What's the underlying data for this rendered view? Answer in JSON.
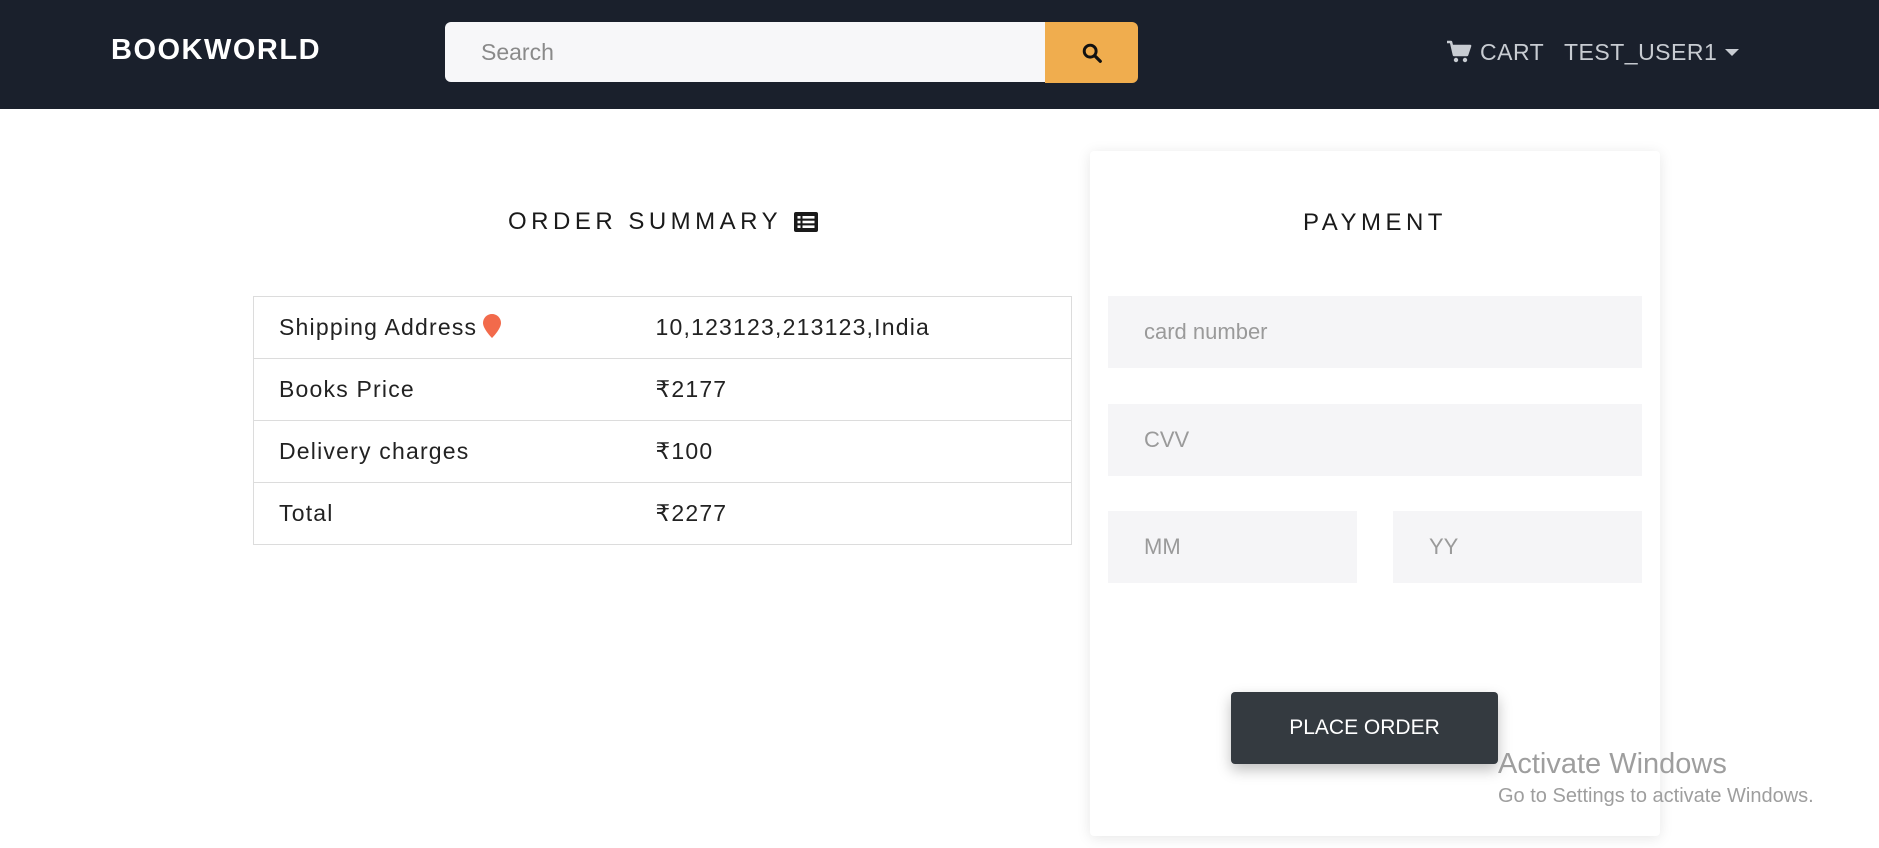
{
  "navbar": {
    "brand": "BOOKWORLD",
    "search_placeholder": "Search",
    "cart_label": "CART",
    "user_label": "TEST_USER1"
  },
  "order_summary": {
    "title": "ORDER SUMMARY",
    "rows": [
      {
        "label": "Shipping Address",
        "value": "10,123123,213123,India"
      },
      {
        "label": "Books Price",
        "value": "₹2177"
      },
      {
        "label": "Delivery charges",
        "value": "₹100"
      },
      {
        "label": "Total",
        "value": "₹2277"
      }
    ]
  },
  "payment": {
    "title": "PAYMENT",
    "card_number_placeholder": "card number",
    "cvv_placeholder": "CVV",
    "mm_placeholder": "MM",
    "yy_placeholder": "YY",
    "place_order_label": "PLACE ORDER"
  },
  "watermark": {
    "title": "Activate Windows",
    "subtitle": "Go to Settings to activate Windows."
  },
  "colors": {
    "navbar_bg": "#1a202c",
    "search_button": "#f0ad4e",
    "place_order_button": "#343a40",
    "pin_icon": "#f26a4b"
  },
  "icons": {
    "search": "search-icon",
    "cart": "cart-icon",
    "caret": "caret-down-icon",
    "list": "list-alt-icon",
    "pin": "map-pin-icon"
  }
}
